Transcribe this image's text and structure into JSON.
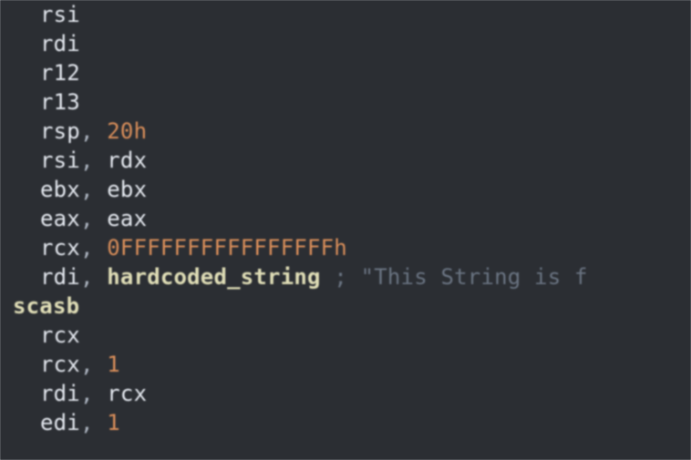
{
  "code": {
    "lines": [
      {
        "indent": 1,
        "tokens": [
          {
            "cls": "reg",
            "text": "rsi"
          }
        ]
      },
      {
        "indent": 1,
        "tokens": [
          {
            "cls": "reg",
            "text": "rdi"
          }
        ]
      },
      {
        "indent": 1,
        "tokens": [
          {
            "cls": "reg",
            "text": "r12"
          }
        ]
      },
      {
        "indent": 1,
        "tokens": [
          {
            "cls": "reg",
            "text": "r13"
          }
        ]
      },
      {
        "indent": 1,
        "tokens": [
          {
            "cls": "reg",
            "text": "rsp"
          },
          {
            "cls": "punct",
            "text": ", "
          },
          {
            "cls": "num",
            "text": "20h"
          }
        ]
      },
      {
        "indent": 1,
        "tokens": [
          {
            "cls": "reg",
            "text": "rsi"
          },
          {
            "cls": "punct",
            "text": ", "
          },
          {
            "cls": "reg",
            "text": "rdx"
          }
        ]
      },
      {
        "indent": 1,
        "tokens": [
          {
            "cls": "reg",
            "text": "ebx"
          },
          {
            "cls": "punct",
            "text": ", "
          },
          {
            "cls": "reg",
            "text": "ebx"
          }
        ]
      },
      {
        "indent": 1,
        "tokens": [
          {
            "cls": "reg",
            "text": "eax"
          },
          {
            "cls": "punct",
            "text": ", "
          },
          {
            "cls": "reg",
            "text": "eax"
          }
        ]
      },
      {
        "indent": 1,
        "tokens": [
          {
            "cls": "reg",
            "text": "rcx"
          },
          {
            "cls": "punct",
            "text": ", "
          },
          {
            "cls": "num",
            "text": "0FFFFFFFFFFFFFFFFh"
          }
        ]
      },
      {
        "indent": 1,
        "tokens": [
          {
            "cls": "reg",
            "text": "rdi"
          },
          {
            "cls": "punct",
            "text": ", "
          },
          {
            "cls": "sym",
            "text": "hardcoded_string"
          },
          {
            "cls": "punct",
            "text": " "
          },
          {
            "cls": "comment",
            "text": "; \"This String is f"
          }
        ]
      },
      {
        "indent": 0.3,
        "tokens": [
          {
            "cls": "mnemonic",
            "text": "scasb"
          }
        ]
      },
      {
        "indent": 1,
        "tokens": [
          {
            "cls": "reg",
            "text": "rcx"
          }
        ]
      },
      {
        "indent": 1,
        "tokens": [
          {
            "cls": "reg",
            "text": "rcx"
          },
          {
            "cls": "punct",
            "text": ", "
          },
          {
            "cls": "num",
            "text": "1"
          }
        ]
      },
      {
        "indent": 1,
        "tokens": [
          {
            "cls": "reg",
            "text": "rdi"
          },
          {
            "cls": "punct",
            "text": ", "
          },
          {
            "cls": "reg",
            "text": "rcx"
          }
        ]
      },
      {
        "indent": 1,
        "tokens": [
          {
            "cls": "reg",
            "text": "edi"
          },
          {
            "cls": "punct",
            "text": ", "
          },
          {
            "cls": "num",
            "text": "1"
          }
        ]
      }
    ]
  }
}
